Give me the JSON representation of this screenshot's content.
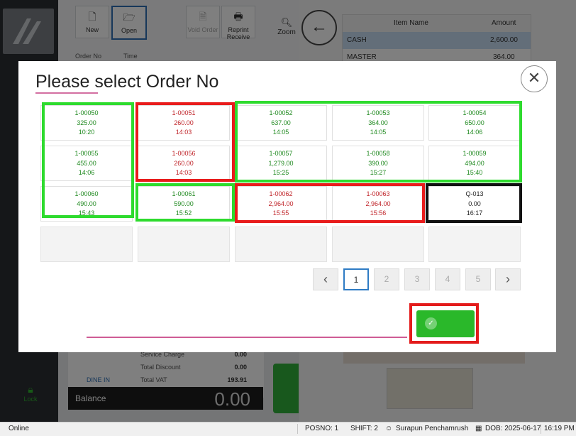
{
  "background": {
    "toolbar": {
      "new_label": "New",
      "open_label": "Open",
      "void_label": "Void Order",
      "reprint_label": "Reprint Receive",
      "zoom_label": "Zoom"
    },
    "order_header": {
      "order_no": "Order No",
      "time": "Time"
    },
    "sidebar": {
      "lock_label": "Lock"
    },
    "payments": {
      "col_item": "Item Name",
      "col_amount": "Amount",
      "rows": [
        {
          "name": "CASH",
          "amount": "2,600.00"
        },
        {
          "name": "MASTER",
          "amount": "364.00"
        }
      ]
    },
    "summary": {
      "service_charge_label": "Service Charge",
      "service_charge_value": "0.00",
      "total_discount_label": "Total Discount",
      "total_discount_value": "0.00",
      "total_vat_label": "Total VAT",
      "total_vat_value": "193.91",
      "dine_in": "DINE IN",
      "balance_label": "Balance",
      "balance_value": "0.00"
    }
  },
  "modal": {
    "title": "Please select Order No",
    "close_icon": "close-icon",
    "orders": [
      {
        "no": "1-00050",
        "amount": "325.00",
        "time": "10:20",
        "color": "green"
      },
      {
        "no": "1-00051",
        "amount": "260.00",
        "time": "14:03",
        "color": "red"
      },
      {
        "no": "1-00052",
        "amount": "637.00",
        "time": "14:05",
        "color": "green"
      },
      {
        "no": "1-00053",
        "amount": "364.00",
        "time": "14:05",
        "color": "green"
      },
      {
        "no": "1-00054",
        "amount": "650.00",
        "time": "14:06",
        "color": "green"
      },
      {
        "no": "1-00055",
        "amount": "455.00",
        "time": "14:06",
        "color": "green"
      },
      {
        "no": "1-00056",
        "amount": "260.00",
        "time": "14:03",
        "color": "red"
      },
      {
        "no": "1-00057",
        "amount": "1,279.00",
        "time": "15:25",
        "color": "green"
      },
      {
        "no": "1-00058",
        "amount": "390.00",
        "time": "15:27",
        "color": "green"
      },
      {
        "no": "1-00059",
        "amount": "494.00",
        "time": "15:40",
        "color": "green"
      },
      {
        "no": "1-00060",
        "amount": "490.00",
        "time": "15:43",
        "color": "green"
      },
      {
        "no": "1-00061",
        "amount": "590.00",
        "time": "15:52",
        "color": "green"
      },
      {
        "no": "1-00062",
        "amount": "2,964.00",
        "time": "15:55",
        "color": "red"
      },
      {
        "no": "1-00063",
        "amount": "2,964.00",
        "time": "15:56",
        "color": "red"
      },
      {
        "no": "Q-013",
        "amount": "0.00",
        "time": "16:17",
        "color": "black"
      }
    ],
    "pagination": {
      "prev_icon": "chevron-left-icon",
      "pages": [
        "1",
        "2",
        "3",
        "4",
        "5"
      ],
      "current": "1",
      "next_icon": "chevron-right-icon"
    },
    "confirm_icon": "check-circle-icon",
    "accent_colors": {
      "green": "#2edb2e",
      "red": "#e81c1c",
      "black": "#111111",
      "button": "#2ab82a"
    }
  },
  "statusbar": {
    "status": "Online",
    "posno": "POSNO: 1",
    "shift": "SHIFT: 2",
    "user": "Surapun Penchamrush",
    "dob": "DOB: 2025-06-17",
    "time": "16:19 PM"
  }
}
